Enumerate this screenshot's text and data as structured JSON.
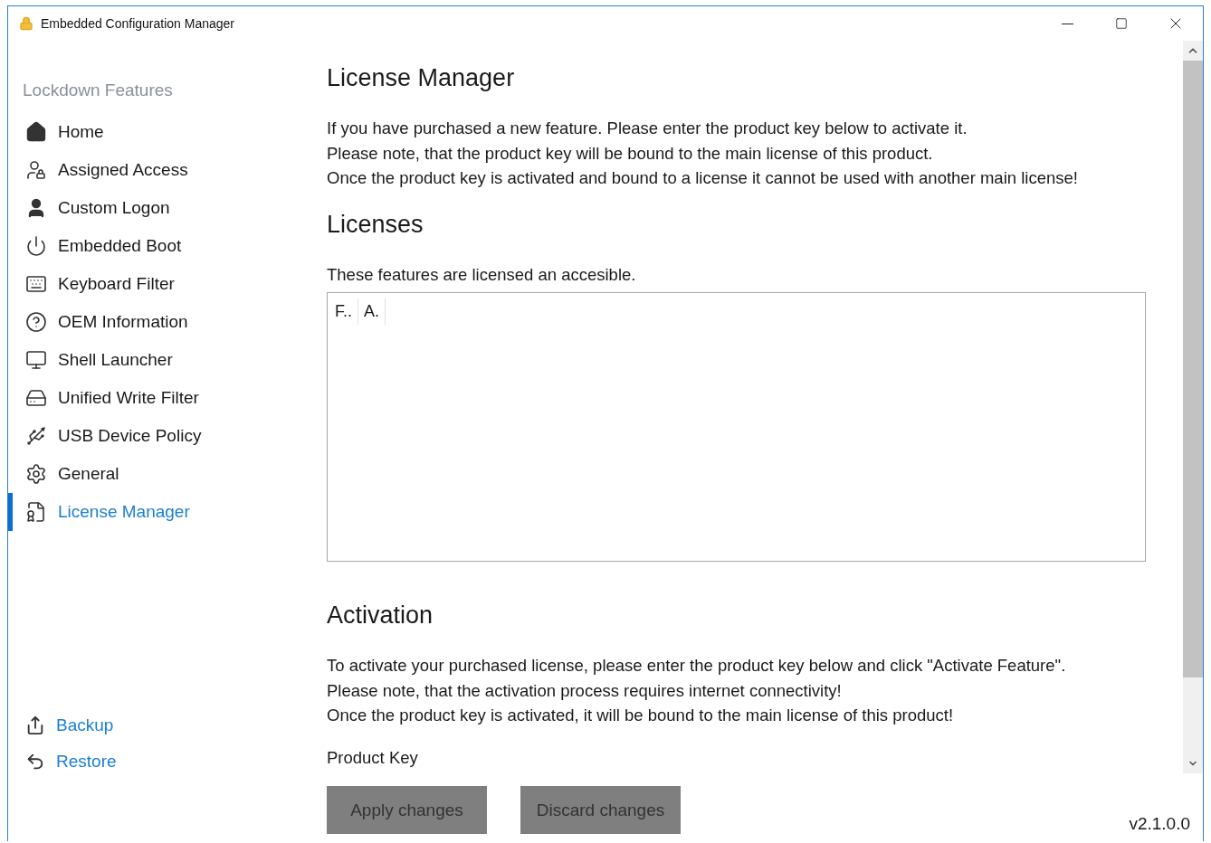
{
  "window": {
    "title": "Embedded Configuration Manager"
  },
  "sidebar": {
    "heading": "Lockdown Features",
    "items": [
      {
        "label": "Home",
        "selected": false
      },
      {
        "label": "Assigned Access",
        "selected": false
      },
      {
        "label": "Custom Logon",
        "selected": false
      },
      {
        "label": "Embedded Boot",
        "selected": false
      },
      {
        "label": "Keyboard Filter",
        "selected": false
      },
      {
        "label": "OEM Information",
        "selected": false
      },
      {
        "label": "Shell Launcher",
        "selected": false
      },
      {
        "label": "Unified Write Filter",
        "selected": false
      },
      {
        "label": "USB Device Policy",
        "selected": false
      },
      {
        "label": "General",
        "selected": false
      },
      {
        "label": "License Manager",
        "selected": true
      }
    ],
    "actions": [
      "Backup",
      "Restore"
    ]
  },
  "content": {
    "sections": [
      {
        "title": "License Manager",
        "paragraphs": [
          "If you have purchased a new feature. Please enter the product key below to activate it.",
          "Please note, that the product key will be bound to the main license of this product.",
          "Once the product key is activated and bound to a license it cannot be used with another main license!"
        ]
      },
      {
        "title": "Licenses",
        "paragraphs": [
          "These features are licensed an accesible."
        ],
        "table": {
          "columns": [
            "F..",
            "A."
          ]
        }
      },
      {
        "title": "Activation",
        "paragraphs": [
          "To activate your purchased license, please enter the product key below and click \"Activate Feature\".",
          "Please note, that the activation process requires internet connectivity!",
          "Once the product key is activated, it will be bound to the main license of this product!"
        ],
        "field_label": "Product Key"
      }
    ]
  },
  "buttons": [
    "Apply changes",
    "Discard changes"
  ],
  "version": "v2.1.0.0"
}
